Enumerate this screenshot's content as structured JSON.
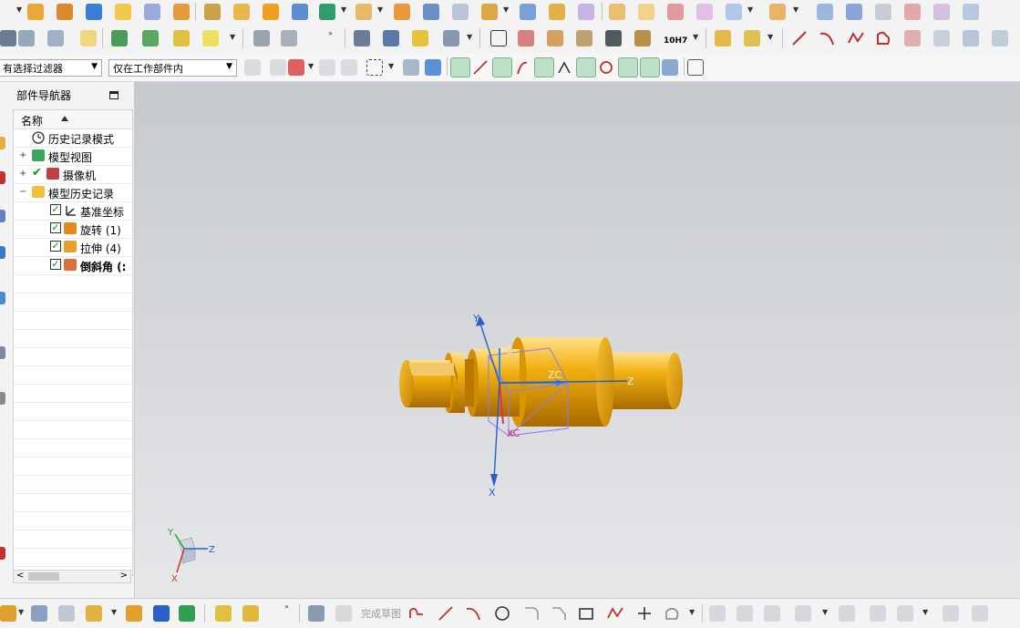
{
  "filters": {
    "type_filter": "有选择过滤器",
    "scope_filter": "仅在工作部件内"
  },
  "navigator": {
    "title": "部件导航器",
    "column_header": "名称",
    "items": [
      {
        "label": "历史记录模式"
      },
      {
        "label": "模型视图"
      },
      {
        "label": "摄像机"
      },
      {
        "label": "模型历史记录"
      },
      {
        "label": "基准坐标"
      },
      {
        "label": "旋转 (1)"
      },
      {
        "label": "拉伸 (4)"
      },
      {
        "label": "倒斜角 (:"
      }
    ]
  },
  "viewport": {
    "axis_labels": {
      "y": "Y",
      "x": "X",
      "z": "Z",
      "yc": "YC",
      "zc": "ZC",
      "xc": "XC"
    },
    "triad_labels": {
      "y": "Y",
      "z": "Z",
      "x": "X"
    },
    "colors": {
      "part": "#f0a800",
      "part_dark": "#b87400",
      "axis": "#2a5fc8",
      "csys_box": "#7c6cff"
    }
  },
  "toolbar_top": {
    "tolerance_label": "10H7"
  },
  "bottom_toolbar": {
    "finish_sketch_label": "完成草图"
  }
}
